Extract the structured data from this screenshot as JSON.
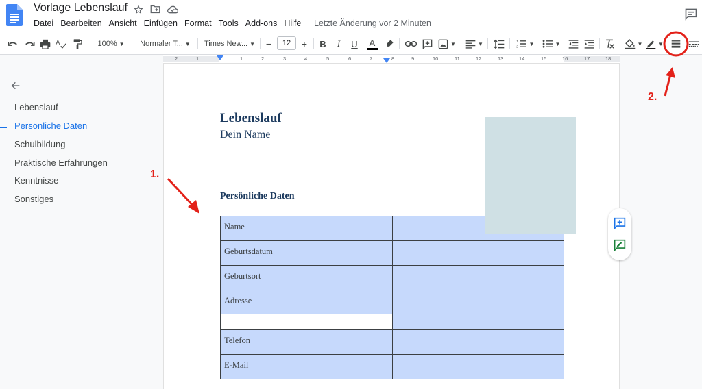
{
  "header": {
    "title": "Vorlage Lebenslauf",
    "menu": [
      "Datei",
      "Bearbeiten",
      "Ansicht",
      "Einfügen",
      "Format",
      "Tools",
      "Add-ons",
      "Hilfe"
    ],
    "last_edit": "Letzte Änderung vor 2 Minuten"
  },
  "toolbar": {
    "zoom": "100%",
    "style": "Normaler T...",
    "font": "Times New...",
    "font_size": "12",
    "minus": "−",
    "plus": "+",
    "bold": "B",
    "italic": "I",
    "underline": "U",
    "text_color": "A"
  },
  "ruler": {
    "numbers": [
      "2",
      "1",
      "1",
      "2",
      "3",
      "4",
      "5",
      "6",
      "7",
      "8",
      "9",
      "10",
      "11",
      "12",
      "13",
      "14",
      "15",
      "16",
      "17",
      "18"
    ]
  },
  "outline": {
    "items": [
      "Lebenslauf",
      "Persönliche Daten",
      "Schulbildung",
      "Praktische Erfahrungen",
      "Kenntnisse",
      "Sonstiges"
    ],
    "active_index": 1
  },
  "document": {
    "heading": "Lebenslauf",
    "name": "Dein Name",
    "section_heading": "Persönliche Daten",
    "table": {
      "rows": [
        "Name",
        "Geburtsdatum",
        "Geburtsort",
        "Adresse",
        "Telefon",
        "E-Mail"
      ]
    }
  },
  "annotations": {
    "one": "1.",
    "two": "2."
  },
  "colors": {
    "accent": "#1a73e8",
    "table_fill": "#c6d9fc",
    "photo_placeholder": "#cfe0e4",
    "annotation_red": "#e32119",
    "heading_navy": "#1c3a5e"
  }
}
